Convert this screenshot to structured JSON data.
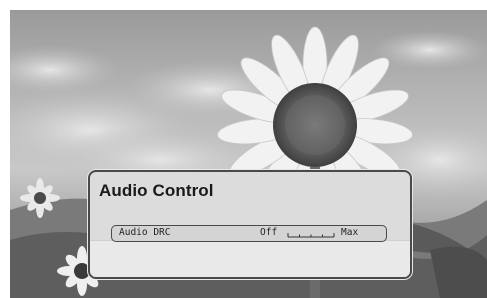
{
  "dialog": {
    "title": "Audio Control"
  },
  "setting": {
    "label": "Audio DRC",
    "min_label": "Off",
    "max_label": "Max",
    "slider_level": 0
  }
}
